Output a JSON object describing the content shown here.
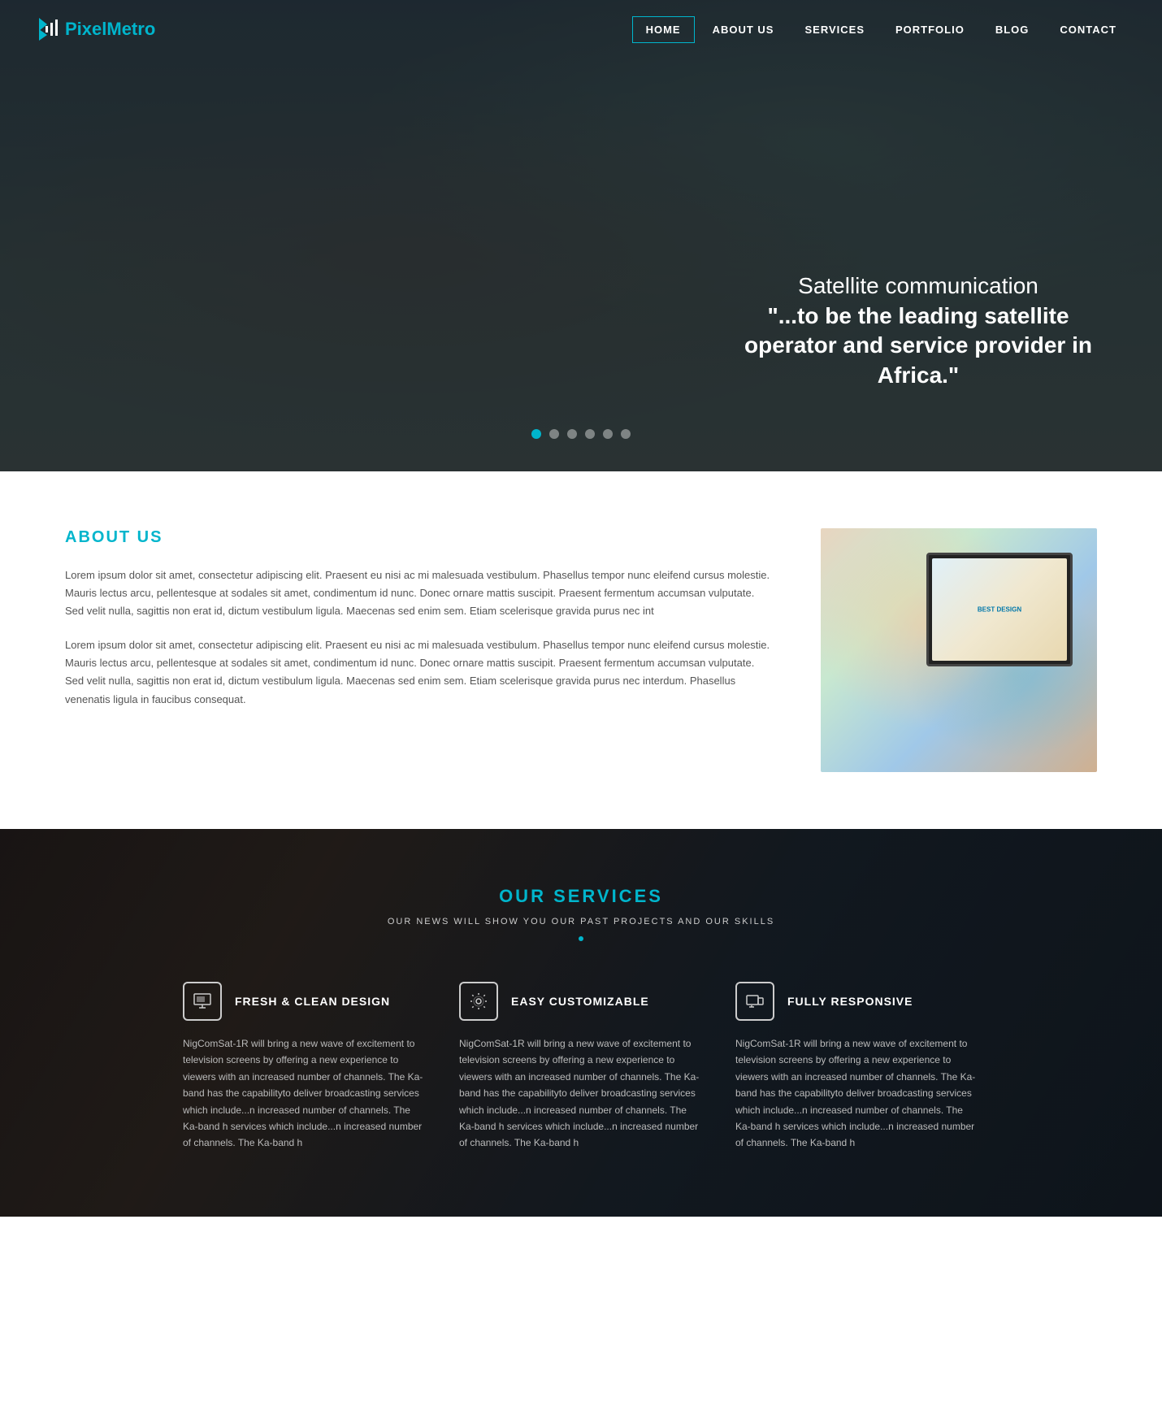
{
  "logo": {
    "pixel": "Pixel",
    "metro": "Metro"
  },
  "nav": {
    "items": [
      {
        "label": "HOME",
        "active": true
      },
      {
        "label": "ABOUT US",
        "active": false
      },
      {
        "label": "SERVICES",
        "active": false
      },
      {
        "label": "PORTFOLIO",
        "active": false
      },
      {
        "label": "BLOG",
        "active": false
      },
      {
        "label": "CONTACT",
        "active": false
      }
    ]
  },
  "hero": {
    "title_line1": "Satellite communication",
    "title_line2": "\"...to be the leading satellite",
    "title_line3": "operator and service provider in Africa.\""
  },
  "about": {
    "title": "ABOUT US",
    "paragraph1": "Lorem ipsum dolor sit amet, consectetur adipiscing elit. Praesent eu nisi ac mi malesuada vestibulum. Phasellus tempor nunc eleifend cursus molestie. Mauris lectus arcu, pellentesque at sodales sit amet, condimentum id nunc. Donec ornare mattis suscipit. Praesent fermentum accumsan vulputate. Sed velit nulla, sagittis non erat id, dictum vestibulum ligula. Maecenas sed enim sem. Etiam scelerisque gravida purus nec int",
    "paragraph2": "Lorem ipsum dolor sit amet, consectetur adipiscing elit. Praesent eu nisi ac mi malesuada vestibulum. Phasellus tempor nunc eleifend cursus molestie. Mauris lectus arcu, pellentesque at sodales sit amet, condimentum id nunc. Donec ornare mattis suscipit. Praesent fermentum accumsan vulputate. Sed velit nulla, sagittis non erat id, dictum vestibulum ligula. Maecenas sed enim sem. Etiam scelerisque gravida purus nec interdum. Phasellus venenatis ligula in faucibus consequat."
  },
  "services": {
    "title": "OUR SERVICES",
    "subtitle": "OUR NEWS WILL SHOW YOU OUR PAST PROJECTS AND OUR SKILLS",
    "items": [
      {
        "name": "FRESH & CLEAN DESIGN",
        "text": "NigComSat-1R will bring a new wave of excitement to television screens by offering a new experience to viewers with an increased number of channels. The Ka-band has the capabilityto deliver broadcasting services which include...n increased number of channels. The Ka-band h services which include...n increased number of channels. The Ka-band h"
      },
      {
        "name": "EASY CUSTOMIZABLE",
        "text": "NigComSat-1R will bring a new wave of excitement to television screens by offering a new experience to viewers with an increased number of channels. The Ka-band has the capabilityto deliver broadcasting services which include...n increased number of channels. The Ka-band h services which include...n increased number of channels. The Ka-band h"
      },
      {
        "name": "FULLY RESPONSIVE",
        "text": "NigComSat-1R will bring a new wave of excitement to television screens by offering a new experience to viewers with an increased number of channels. The Ka-band has the capabilityto deliver broadcasting services which include...n increased number of channels. The Ka-band h services which include...n increased number of channels. The Ka-band h"
      }
    ]
  },
  "colors": {
    "accent": "#00b5cc",
    "dark": "#1a2530",
    "text": "#555555"
  }
}
